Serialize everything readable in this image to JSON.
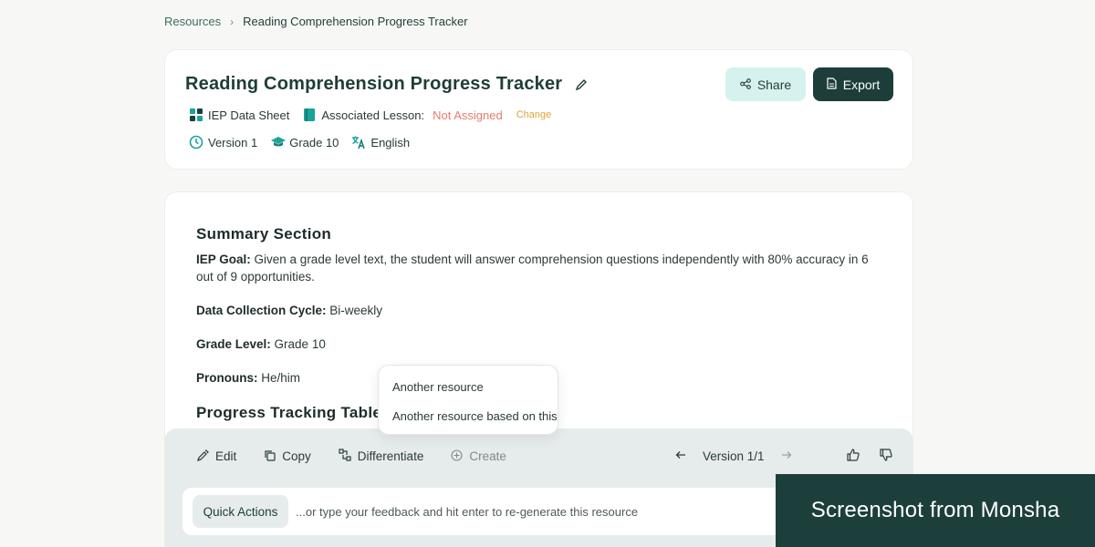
{
  "breadcrumb": {
    "parent": "Resources",
    "separator": "›",
    "current": "Reading Comprehension Progress Tracker"
  },
  "header": {
    "title": "Reading Comprehension Progress Tracker",
    "resource_type": "IEP Data Sheet",
    "associated_lesson_label": "Associated Lesson:",
    "associated_lesson_value": "Not Assigned",
    "change_label": "Change",
    "version": "Version 1",
    "grade": "Grade 10",
    "language": "English",
    "share_label": "Share",
    "export_label": "Export"
  },
  "content": {
    "summary_title": "Summary Section",
    "iep_goal_label": "IEP Goal:",
    "iep_goal_text": " Given a grade level text, the student will answer comprehension questions independently with 80% accuracy in 6 out of 9 opportunities.",
    "cycle_label": "Data Collection Cycle:",
    "cycle_value": " Bi-weekly",
    "grade_label": "Grade Level:",
    "grade_value": " Grade 10",
    "pronouns_label": "Pronouns:",
    "pronouns_value": " He/him",
    "table_title": "Progress Tracking Table"
  },
  "dropdown": {
    "items": [
      "Another resource",
      "Another resource based on this"
    ]
  },
  "toolbar": {
    "edit_label": "Edit",
    "copy_label": "Copy",
    "differentiate_label": "Differentiate",
    "create_label": "Create",
    "version_label": "Version 1/1"
  },
  "input": {
    "quick_actions_label": "Quick Actions",
    "placeholder": "...or type your feedback and hit enter to re-generate this resource"
  },
  "watermark": {
    "text": "Screenshot from Monsha"
  },
  "colors": {
    "primary_dark": "#1d3d3b",
    "accent_light": "#d6f2ee",
    "warning": "#e87c6c",
    "change": "#e0a13a",
    "teal_icon": "#1aa39a"
  }
}
